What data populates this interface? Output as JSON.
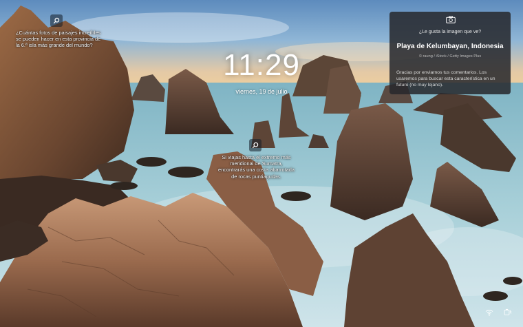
{
  "lock_screen": {
    "time": "11:29",
    "date": "viernes, 19 de julio"
  },
  "hints": [
    {
      "text": "¿Cuántas fotos de paisajes increíbles se pueden hacer en esta provincia de la 6.ª isla más grande del mundo?"
    },
    {
      "text": "Si viajas hasta el extremo más meridional de Sumatra, encontrarás una costa abarrotada de rocas puntiagudas."
    }
  ],
  "info_panel": {
    "question": "¿Le gusta la imagen que ve?",
    "title": "Playa de Kelumbayan, Indonesia",
    "credit": "© raung / iStock / Getty Images Plus",
    "body": "Gracias por enviarnos tus comentarios. Los usaremos para buscar esta característica en un futuro (no muy lejano)."
  },
  "icons": {
    "hint": "search-icon",
    "camera": "camera-icon",
    "wifi": "wifi-icon",
    "battery": "battery-icon"
  }
}
